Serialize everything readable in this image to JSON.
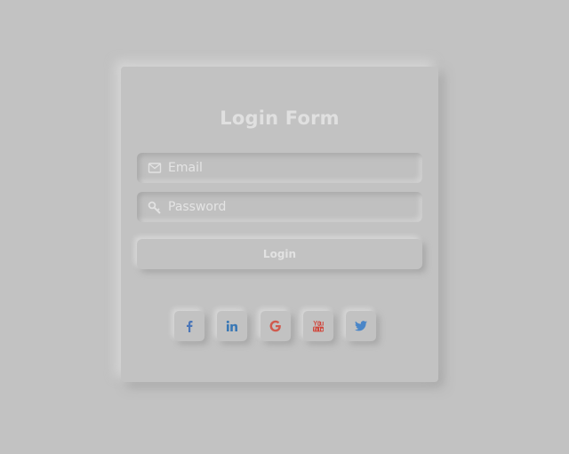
{
  "form": {
    "title": "Login Form",
    "email_placeholder": "Email",
    "password_placeholder": "Password",
    "login_label": "Login"
  },
  "icons": {
    "email": "envelope-icon",
    "password": "key-icon"
  },
  "socials": [
    {
      "name": "facebook",
      "icon": "facebook-icon",
      "color": "#4b76b8"
    },
    {
      "name": "linkedin",
      "icon": "linkedin-icon",
      "color": "#3a78b5"
    },
    {
      "name": "google",
      "icon": "google-icon",
      "color": "#d05a4e"
    },
    {
      "name": "youtube",
      "icon": "youtube-icon",
      "color": "#d1453a"
    },
    {
      "name": "twitter",
      "icon": "twitter-icon",
      "color": "#4a86c8"
    }
  ]
}
